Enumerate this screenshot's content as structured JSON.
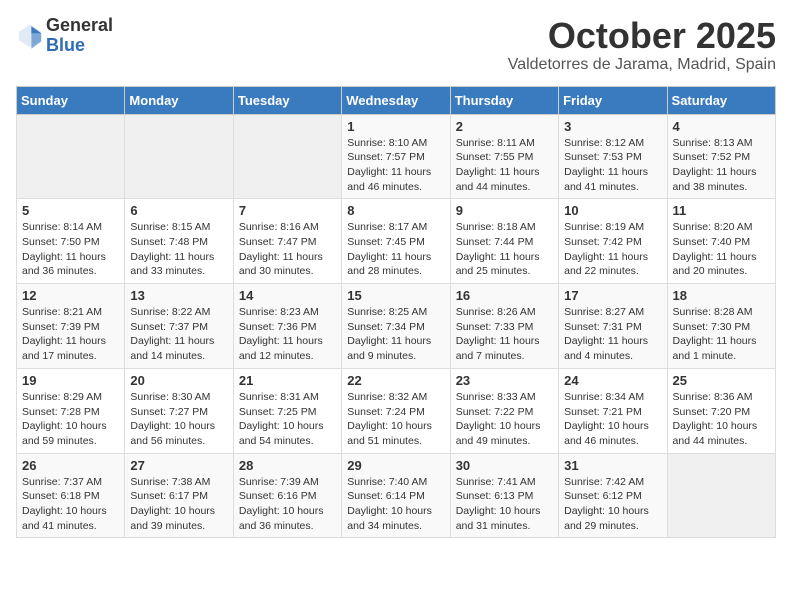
{
  "header": {
    "logo_line1": "General",
    "logo_line2": "Blue",
    "month_title": "October 2025",
    "location": "Valdetorres de Jarama, Madrid, Spain"
  },
  "weekdays": [
    "Sunday",
    "Monday",
    "Tuesday",
    "Wednesday",
    "Thursday",
    "Friday",
    "Saturday"
  ],
  "weeks": [
    [
      {
        "day": "",
        "info": ""
      },
      {
        "day": "",
        "info": ""
      },
      {
        "day": "",
        "info": ""
      },
      {
        "day": "1",
        "info": "Sunrise: 8:10 AM\nSunset: 7:57 PM\nDaylight: 11 hours and 46 minutes."
      },
      {
        "day": "2",
        "info": "Sunrise: 8:11 AM\nSunset: 7:55 PM\nDaylight: 11 hours and 44 minutes."
      },
      {
        "day": "3",
        "info": "Sunrise: 8:12 AM\nSunset: 7:53 PM\nDaylight: 11 hours and 41 minutes."
      },
      {
        "day": "4",
        "info": "Sunrise: 8:13 AM\nSunset: 7:52 PM\nDaylight: 11 hours and 38 minutes."
      }
    ],
    [
      {
        "day": "5",
        "info": "Sunrise: 8:14 AM\nSunset: 7:50 PM\nDaylight: 11 hours and 36 minutes."
      },
      {
        "day": "6",
        "info": "Sunrise: 8:15 AM\nSunset: 7:48 PM\nDaylight: 11 hours and 33 minutes."
      },
      {
        "day": "7",
        "info": "Sunrise: 8:16 AM\nSunset: 7:47 PM\nDaylight: 11 hours and 30 minutes."
      },
      {
        "day": "8",
        "info": "Sunrise: 8:17 AM\nSunset: 7:45 PM\nDaylight: 11 hours and 28 minutes."
      },
      {
        "day": "9",
        "info": "Sunrise: 8:18 AM\nSunset: 7:44 PM\nDaylight: 11 hours and 25 minutes."
      },
      {
        "day": "10",
        "info": "Sunrise: 8:19 AM\nSunset: 7:42 PM\nDaylight: 11 hours and 22 minutes."
      },
      {
        "day": "11",
        "info": "Sunrise: 8:20 AM\nSunset: 7:40 PM\nDaylight: 11 hours and 20 minutes."
      }
    ],
    [
      {
        "day": "12",
        "info": "Sunrise: 8:21 AM\nSunset: 7:39 PM\nDaylight: 11 hours and 17 minutes."
      },
      {
        "day": "13",
        "info": "Sunrise: 8:22 AM\nSunset: 7:37 PM\nDaylight: 11 hours and 14 minutes."
      },
      {
        "day": "14",
        "info": "Sunrise: 8:23 AM\nSunset: 7:36 PM\nDaylight: 11 hours and 12 minutes."
      },
      {
        "day": "15",
        "info": "Sunrise: 8:25 AM\nSunset: 7:34 PM\nDaylight: 11 hours and 9 minutes."
      },
      {
        "day": "16",
        "info": "Sunrise: 8:26 AM\nSunset: 7:33 PM\nDaylight: 11 hours and 7 minutes."
      },
      {
        "day": "17",
        "info": "Sunrise: 8:27 AM\nSunset: 7:31 PM\nDaylight: 11 hours and 4 minutes."
      },
      {
        "day": "18",
        "info": "Sunrise: 8:28 AM\nSunset: 7:30 PM\nDaylight: 11 hours and 1 minute."
      }
    ],
    [
      {
        "day": "19",
        "info": "Sunrise: 8:29 AM\nSunset: 7:28 PM\nDaylight: 10 hours and 59 minutes."
      },
      {
        "day": "20",
        "info": "Sunrise: 8:30 AM\nSunset: 7:27 PM\nDaylight: 10 hours and 56 minutes."
      },
      {
        "day": "21",
        "info": "Sunrise: 8:31 AM\nSunset: 7:25 PM\nDaylight: 10 hours and 54 minutes."
      },
      {
        "day": "22",
        "info": "Sunrise: 8:32 AM\nSunset: 7:24 PM\nDaylight: 10 hours and 51 minutes."
      },
      {
        "day": "23",
        "info": "Sunrise: 8:33 AM\nSunset: 7:22 PM\nDaylight: 10 hours and 49 minutes."
      },
      {
        "day": "24",
        "info": "Sunrise: 8:34 AM\nSunset: 7:21 PM\nDaylight: 10 hours and 46 minutes."
      },
      {
        "day": "25",
        "info": "Sunrise: 8:36 AM\nSunset: 7:20 PM\nDaylight: 10 hours and 44 minutes."
      }
    ],
    [
      {
        "day": "26",
        "info": "Sunrise: 7:37 AM\nSunset: 6:18 PM\nDaylight: 10 hours and 41 minutes."
      },
      {
        "day": "27",
        "info": "Sunrise: 7:38 AM\nSunset: 6:17 PM\nDaylight: 10 hours and 39 minutes."
      },
      {
        "day": "28",
        "info": "Sunrise: 7:39 AM\nSunset: 6:16 PM\nDaylight: 10 hours and 36 minutes."
      },
      {
        "day": "29",
        "info": "Sunrise: 7:40 AM\nSunset: 6:14 PM\nDaylight: 10 hours and 34 minutes."
      },
      {
        "day": "30",
        "info": "Sunrise: 7:41 AM\nSunset: 6:13 PM\nDaylight: 10 hours and 31 minutes."
      },
      {
        "day": "31",
        "info": "Sunrise: 7:42 AM\nSunset: 6:12 PM\nDaylight: 10 hours and 29 minutes."
      },
      {
        "day": "",
        "info": ""
      }
    ]
  ]
}
